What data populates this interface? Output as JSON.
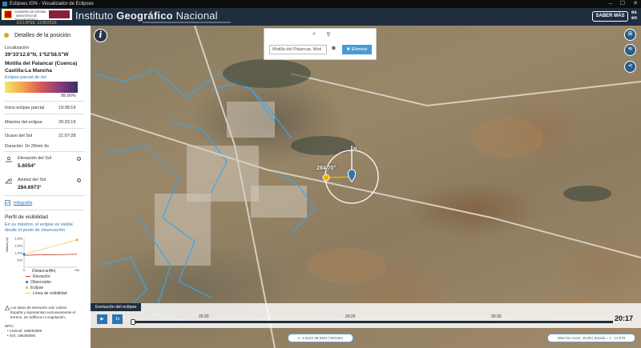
{
  "window": {
    "title": "Eclipses IGN - Visualizador de Eclipses",
    "controls": [
      "–",
      "☐",
      "✕"
    ]
  },
  "header": {
    "gov_text": "GOBIERNO DE ESPAÑA · MINISTERIO DE TRANSPORTES Y MOVILIDAD SOSTENIBLE",
    "eclipse_date": "ECLIPSE 12/8/2026",
    "brand_light": "Instituto",
    "brand_bold": "Geográfico",
    "brand_end": "Nacional",
    "saber_mas": "SABER MÁS",
    "lang_es": "es",
    "lang_en": "en"
  },
  "sidebar": {
    "section_title": "Detalles de la posición",
    "location_label": "Localización",
    "coords": "39°33'12.6\"N, 1°52'58.5\"W",
    "place": "Motilla del Palancar (Cuenca)",
    "region": "Castilla-La Mancha",
    "partial_label": "Eclipse parcial de sol",
    "partial_value": "99.90%",
    "rows": [
      {
        "label": "Inicio eclipse parcial",
        "value": "19:38:19"
      },
      {
        "label": "Máximo del eclipse",
        "value": "20:33:19"
      },
      {
        "label": "Ocaso del Sol",
        "value": "21:07:28"
      }
    ],
    "duration": "Duración: 1h 29min 9s",
    "elev_label": "Elevación del Sol",
    "elev_value": "5.6054°",
    "azim_label": "Azimut del Sol",
    "azim_value": "284.6973°",
    "infografia": "Infografía",
    "perfil_title": "Perfil de visibilidad",
    "perfil_desc_1": "En su máximo, el eclipse es visible",
    "perfil_desc_2": "desde el punto de observación",
    "chart_ylabel": "Altitud (m)",
    "chart_xlabel": "Distancia (m)",
    "legend": [
      "Elevación",
      "Observador",
      "Eclipse",
      "Línea de visibilidad"
    ],
    "note_1": "Los datos de elevación solo cubren",
    "note_2": "España y representan exclusivamente el",
    "note_3": "terreno, sin edificios ni vegetación.",
    "npic": "NPIC:",
    "android": "• Android: 198250589",
    "ios": "• iOS: 198250594",
    "colors": {
      "gold": "#f0b400",
      "blue": "#2c74b3",
      "dark": "#1f2d3f"
    }
  },
  "chart_data": {
    "type": "line",
    "xlabel": "Distancia (m)",
    "ylabel": "Altitud (m)",
    "x_ticks": [
      "0",
      "5k",
      "10k"
    ],
    "y_ticks": [
      "500",
      "1,000",
      "1,500",
      "2,000"
    ],
    "xlim": [
      0,
      10000
    ],
    "ylim": [
      0,
      2000
    ],
    "series": [
      {
        "name": "Elevación",
        "x": [
          0,
          2000,
          4000,
          6000,
          8000,
          10000
        ],
        "values": [
          820,
          850,
          870,
          860,
          880,
          900
        ],
        "color": "#c0392b"
      },
      {
        "name": "Línea de visibilidad",
        "x": [
          0,
          10000
        ],
        "values": [
          900,
          1900
        ],
        "color": "#f0b400"
      }
    ]
  },
  "map": {
    "azimuth_label": "284.70°",
    "north_label": "N",
    "search_placeholder": "Motilla del Palancar, Moti",
    "delete_label": "Eliminar",
    "timeline_title": "Evolución del eclipse",
    "play_label": "▶",
    "speed_label": "1x",
    "ticks": [
      "20:20",
      "20:25",
      "20:30"
    ],
    "current_time": "20:17",
    "coords_readout": "-1,9142  39,5301 | WGS84",
    "zoom_readout": "Nivel de zoom: 15,05  |  Escala = 1 : 12.078"
  }
}
